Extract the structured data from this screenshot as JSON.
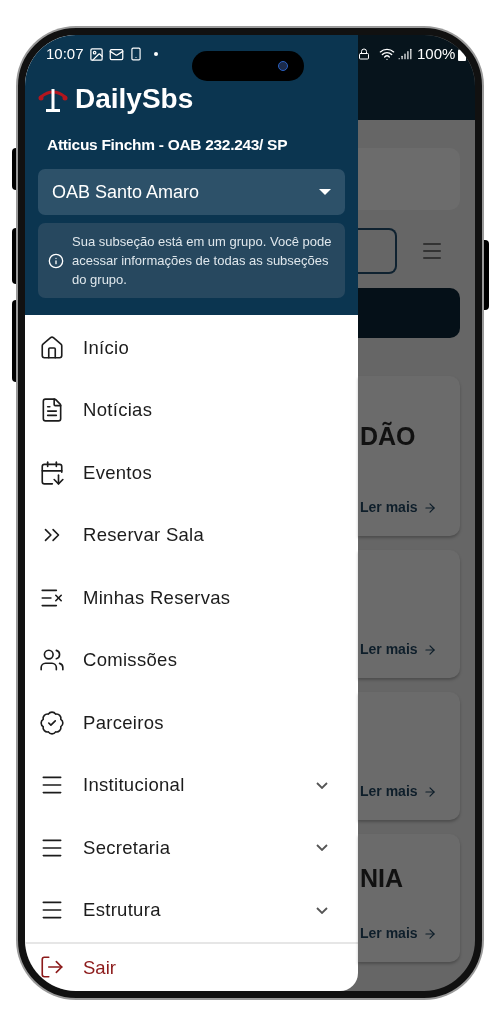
{
  "status_bar": {
    "time": "10:07",
    "battery": "100%"
  },
  "drawer": {
    "app_name": "DailySbs",
    "user": "Atticus Finchm - OAB 232.243/ SP",
    "subsection_select": {
      "value": "OAB Santo Amaro"
    },
    "info_text": "Sua subseção está em um grupo. Você pode acessar informações de todas as subseções do grupo.",
    "menu": [
      {
        "label": "Início",
        "kind": "link"
      },
      {
        "label": "Notícias",
        "kind": "link"
      },
      {
        "label": "Eventos",
        "kind": "link"
      },
      {
        "label": "Reservar Sala",
        "kind": "link"
      },
      {
        "label": "Minhas Reservas",
        "kind": "link"
      },
      {
        "label": "Comissões",
        "kind": "link"
      },
      {
        "label": "Parceiros",
        "kind": "link"
      },
      {
        "label": "Institucional",
        "kind": "group",
        "expanded": false
      },
      {
        "label": "Secretaria",
        "kind": "group",
        "expanded": false
      },
      {
        "label": "Estrutura",
        "kind": "group",
        "expanded": false
      }
    ],
    "logout": {
      "label": "Sair"
    }
  },
  "background_page": {
    "cards": [
      {
        "title": "DÃO",
        "link": "Ler mais"
      },
      {
        "link": "Ler mais"
      },
      {
        "link": "Ler mais"
      },
      {
        "title": "NIA",
        "link": "Ler mais"
      }
    ]
  }
}
